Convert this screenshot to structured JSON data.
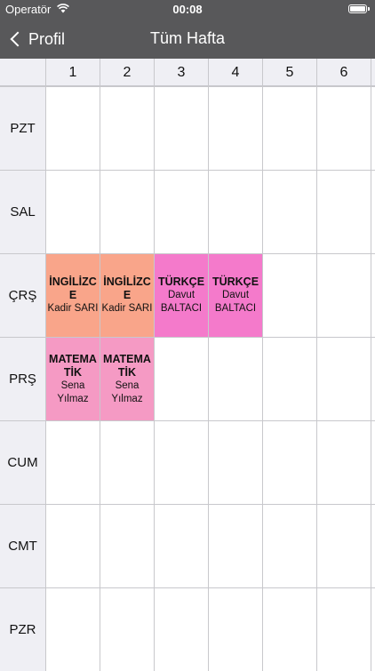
{
  "status": {
    "carrier": "Operatör",
    "time": "00:08"
  },
  "nav": {
    "back_label": "Profil",
    "title": "Tüm Hafta"
  },
  "columns": [
    "1",
    "2",
    "3",
    "4",
    "5",
    "6"
  ],
  "rows": [
    "PZT",
    "SAL",
    "ÇRŞ",
    "PRŞ",
    "CUM",
    "CMT",
    "PZR"
  ],
  "lessons": [
    {
      "row": 2,
      "col": 0,
      "name": "İNGİLİZCE",
      "teacher": "Kadir SARI",
      "color": "#f9a58a"
    },
    {
      "row": 2,
      "col": 1,
      "name": "İNGİLİZCE",
      "teacher": "Kadir SARI",
      "color": "#f9a58a"
    },
    {
      "row": 2,
      "col": 2,
      "name": "TÜRKÇE",
      "teacher": "Davut BALTACI",
      "color": "#f47acb"
    },
    {
      "row": 2,
      "col": 3,
      "name": "TÜRKÇE",
      "teacher": "Davut BALTACI",
      "color": "#f47acb"
    },
    {
      "row": 3,
      "col": 0,
      "name": "MATEMATİK",
      "teacher": "Sena Yılmaz",
      "color": "#f59ac4"
    },
    {
      "row": 3,
      "col": 1,
      "name": "MATEMATİK",
      "teacher": "Sena Yılmaz",
      "color": "#f59ac4"
    }
  ]
}
